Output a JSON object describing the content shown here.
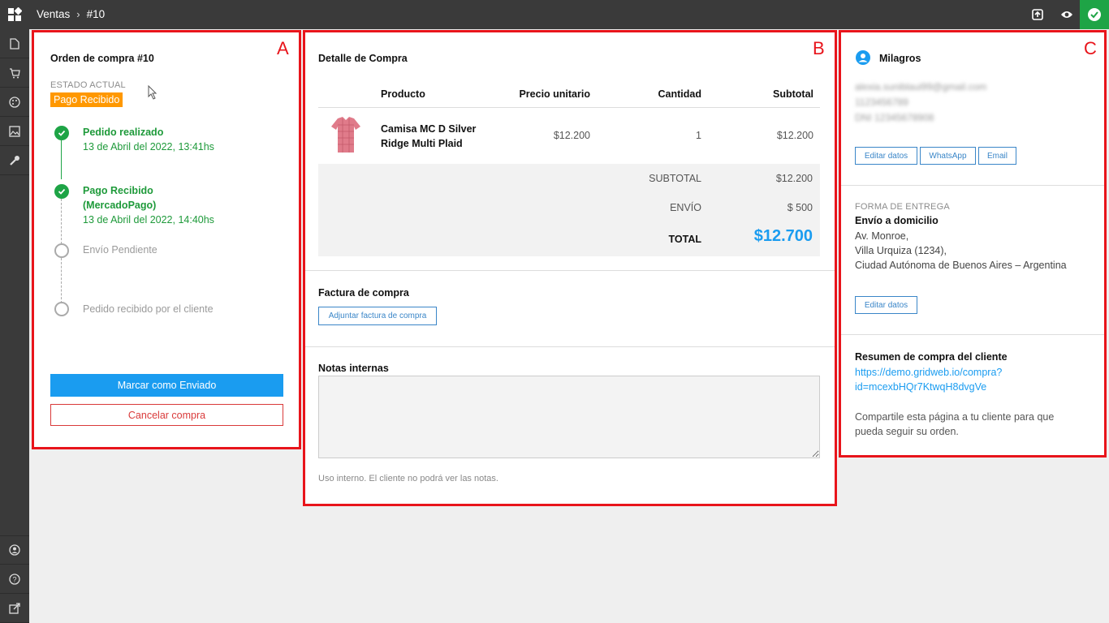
{
  "topbar": {
    "breadcrumb": [
      "Ventas",
      "#10"
    ],
    "separator": "›",
    "icons": [
      "dashboard-icon",
      "archive-icon",
      "eye-icon",
      "check-badge-icon"
    ]
  },
  "sidebar": {
    "icons": [
      "page-icon",
      "cart-icon",
      "palette-icon",
      "image-icon",
      "wrench-icon",
      "user-circle-icon",
      "help-icon",
      "external-link-icon"
    ]
  },
  "annotations": {
    "a": "A",
    "b": "B",
    "c": "C"
  },
  "orden": {
    "title": "Orden de compra #10",
    "estado_label": "ESTADO ACTUAL",
    "estado_value": "Pago Recibido",
    "steps": [
      {
        "title": "Pedido realizado",
        "date": "13 de Abril del 2022, 13:41hs",
        "done": true
      },
      {
        "title": "Pago Recibido",
        "title2": "(MercadoPago)",
        "date": "13 de Abril del 2022, 14:40hs",
        "done": true
      },
      {
        "title": "Envío Pendiente",
        "done": false
      },
      {
        "title": "Pedido recibido por el cliente",
        "done": false
      }
    ],
    "primary_button": "Marcar como Enviado",
    "cancel_button": "Cancelar compra"
  },
  "detalle": {
    "title": "Detalle de Compra",
    "headers": [
      "Producto",
      "Precio unitario",
      "Cantidad",
      "Subtotal"
    ],
    "item": {
      "name_line1": "Camisa MC D Silver",
      "name_line2": "Ridge Multi Plaid",
      "price": "$12.200",
      "qty": "1",
      "subtotal": "$12.200"
    },
    "summary": {
      "subtotal_label": "SUBTOTAL",
      "subtotal_value": "$12.200",
      "envio_label": "ENVÍO",
      "envio_value": "$ 500",
      "total_label": "TOTAL",
      "total_value": "$12.700"
    },
    "factura_title": "Factura de compra",
    "factura_button": "Adjuntar factura de compra",
    "notas_title": "Notas internas",
    "notas_value": "",
    "notas_help": "Uso interno. El cliente no podrá ver las notas."
  },
  "cliente": {
    "name": "Milagros",
    "email": "alexia.suniblaui99@gmail.com",
    "phone": "1123456789",
    "dni": "DNI 12345678908",
    "buttons": [
      "Editar datos",
      "WhatsApp",
      "Email"
    ],
    "entrega_label": "FORMA DE ENTREGA",
    "entrega_type": "Envío a domicilio",
    "address": [
      "Av. Monroe,",
      "Villa Urquiza (1234),",
      "Ciudad Autónoma de Buenos Aires – Argentina"
    ],
    "entrega_button": "Editar datos",
    "resumen_title": "Resumen de compra del cliente",
    "resumen_link1": "https://demo.gridweb.io/compra?",
    "resumen_link2": "id=mcexbHQr7KtwqH8dvgVe",
    "resumen_text1": "Compartile esta página a tu cliente para que",
    "resumen_text2": "pueda seguir su orden."
  },
  "colors": {
    "accent": "#1a9cf0",
    "success": "#1ea446",
    "badge": "#ff9800",
    "danger": "#d93a3a",
    "annotation": "#e8141b"
  }
}
